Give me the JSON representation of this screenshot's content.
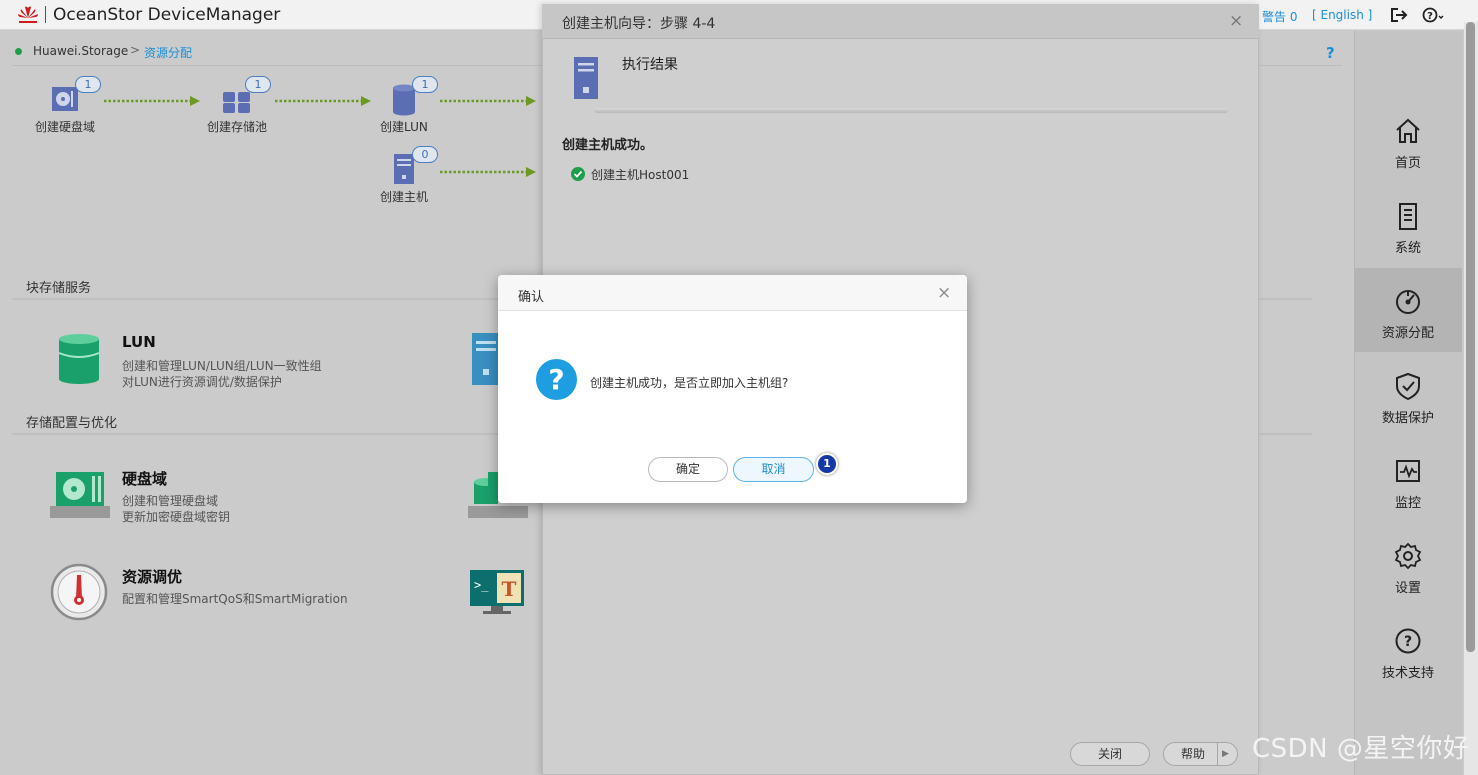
{
  "topbar": {
    "logo_icon": "huawei-logo-icon",
    "title": "OceanStor DeviceManager",
    "alarm": "警告 0",
    "language": "[ English ]",
    "logout_icon": "logout-icon",
    "help_icon": "help-icon"
  },
  "breadcrumb": {
    "root": "Huawei.Storage",
    "separator": ">",
    "current": "资源分配",
    "help": "?"
  },
  "flow": {
    "items": [
      {
        "label": "创建硬盘域",
        "count": "1",
        "icon": "disk-domain-icon"
      },
      {
        "label": "创建存储池",
        "count": "1",
        "icon": "storage-pool-icon"
      },
      {
        "label": "创建LUN",
        "count": "1",
        "icon": "lun-icon"
      },
      {
        "label": "创建主机",
        "count": "0",
        "icon": "host-icon"
      }
    ]
  },
  "sections": {
    "block": "块存储服务",
    "config": "存储配置与优化"
  },
  "cards": {
    "lun": {
      "title": "LUN",
      "desc1": "创建和管理LUN/LUN组/LUN一致性组",
      "desc2": "对LUN进行资源调优/数据保护"
    },
    "disk_domain": {
      "title": "硬盘域",
      "desc1": "创建和管理硬盘域",
      "desc2": "更新加密硬盘域密钥"
    },
    "tuning": {
      "title": "资源调优",
      "desc1": "配置和管理SmartQoS和SmartMigration"
    }
  },
  "right_nav": {
    "items": [
      {
        "label": "首页",
        "icon": "home-icon"
      },
      {
        "label": "系统",
        "icon": "system-icon"
      },
      {
        "label": "资源分配",
        "icon": "resource-allocation-icon",
        "active": true
      },
      {
        "label": "数据保护",
        "icon": "shield-icon"
      },
      {
        "label": "监控",
        "icon": "monitor-icon"
      },
      {
        "label": "设置",
        "icon": "gear-icon"
      },
      {
        "label": "技术支持",
        "icon": "support-icon"
      }
    ]
  },
  "wizard": {
    "title": "创建主机向导：步骤 4-4",
    "close": "×",
    "step_title": "执行结果",
    "success_message": "创建主机成功。",
    "result_item": "创建主机Host001",
    "close_button": "关闭",
    "help_button": "帮助",
    "help_arrow": "▶"
  },
  "dialog": {
    "title": "确认",
    "close": "×",
    "icon": "?",
    "message": "创建主机成功，是否立即加入主机组?",
    "ok": "确定",
    "cancel": "取消",
    "step_marker": "1"
  },
  "watermark": "CSDN @星空你好",
  "colors": {
    "accent": "#1a8fd6",
    "success": "#1f9d4a",
    "arrow": "#6a9a22",
    "icon_blue": "#5b6eb3",
    "icon_green": "#1aa06a",
    "marker": "#1537a8"
  }
}
